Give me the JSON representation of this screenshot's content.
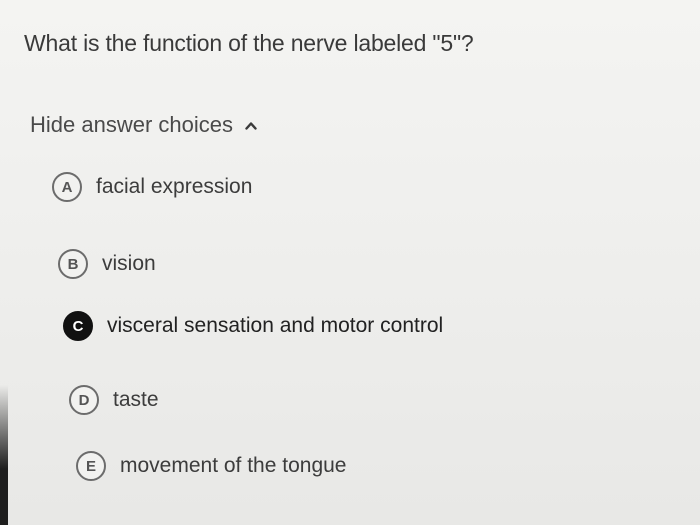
{
  "question": {
    "text": "What is the function of the nerve labeled \"5\"?"
  },
  "toggle": {
    "label": "Hide answer choices",
    "icon": "chevron-up-icon"
  },
  "choices": [
    {
      "letter": "A",
      "text": "facial expression",
      "selected": false
    },
    {
      "letter": "B",
      "text": "vision",
      "selected": false
    },
    {
      "letter": "C",
      "text": "visceral sensation and motor control",
      "selected": true
    },
    {
      "letter": "D",
      "text": "taste",
      "selected": false
    },
    {
      "letter": "E",
      "text": "movement of the tongue",
      "selected": false
    }
  ],
  "colors": {
    "background": "#efefed",
    "text": "#3a3a3a",
    "selected_badge": "#111111",
    "badge_border": "#6c6c6c"
  }
}
